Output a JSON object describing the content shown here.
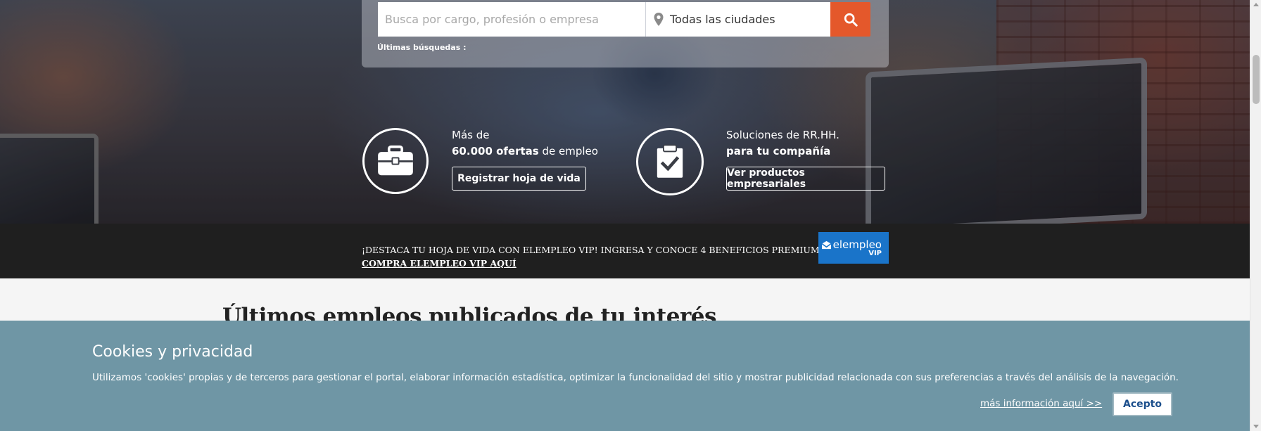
{
  "search": {
    "query_placeholder": "Busca por cargo, profesión o empresa",
    "city_value": "Todas las ciudades",
    "button_icon": "search-icon",
    "last_searches_label": "Últimas búsquedas :"
  },
  "features": [
    {
      "icon": "briefcase-icon",
      "line1": "Más de",
      "line2_bold": "60.000 ofertas",
      "line2_rest": " de empleo",
      "button_label": "Registrar hoja de vida"
    },
    {
      "icon": "clipboard-check-icon",
      "line1": "Soluciones de RR.HH.",
      "line2_bold": "para tu compañía",
      "line2_rest": "",
      "button_label": "Ver productos empresariales"
    }
  ],
  "promo": {
    "text": "¡DESTACA TU HOJA DE VIDA CON ELEMPLEO VIP! INGRESA Y CONOCE 4 BENEFICIOS PREMIUM",
    "link": "COMPRA ELEMPLEO VIP AQUÍ",
    "badge_brand": "elempleo",
    "badge_sub": "VIP"
  },
  "content": {
    "section_title": "Últimos empleos publicados de tu interés"
  },
  "cookies": {
    "title": "Cookies y privacidad",
    "text": "Utilizamos 'cookies' propias y de terceros para gestionar el portal, elaborar información estadística, optimizar la funcionalidad del sitio y mostrar publicidad relacionada con sus preferencias a través del análisis de la navegación.",
    "more_info": "más información aquí >>",
    "accept": "Acepto"
  },
  "colors": {
    "accent": "#e4582b",
    "promo_bg": "#1f1f1f",
    "vip_blue": "#1a74c9",
    "cookie_bg": "#6f96a5"
  }
}
